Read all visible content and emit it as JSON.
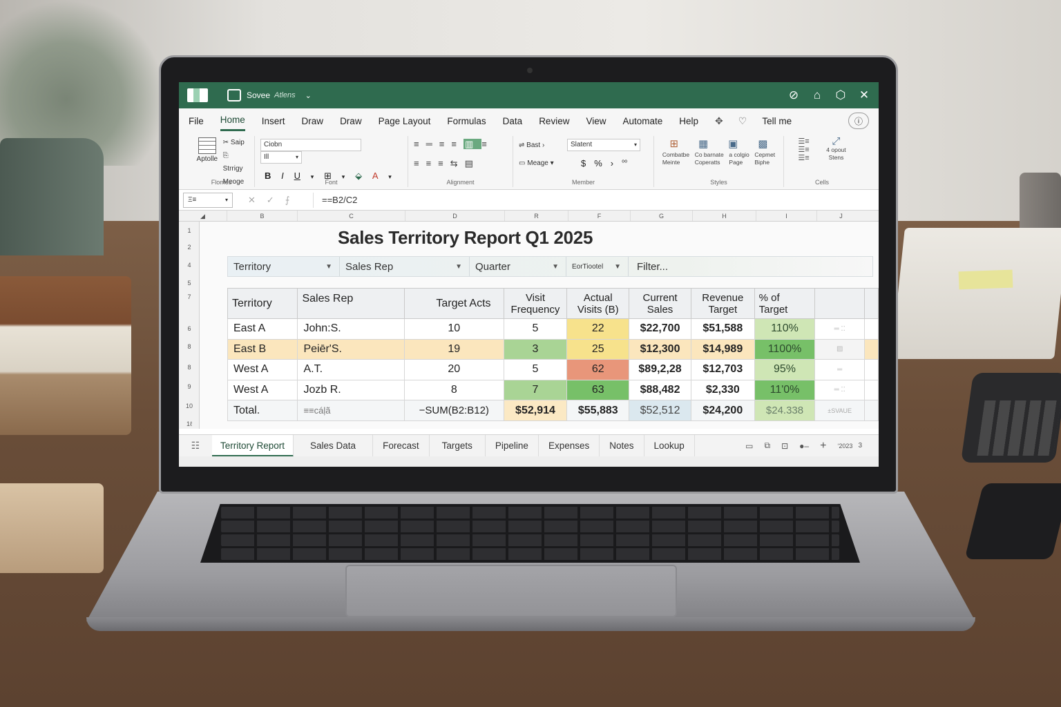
{
  "titlebar": {
    "save_label": "Sovee",
    "sub_label": "Atlens"
  },
  "menu": {
    "items": [
      "File",
      "Home",
      "Insert",
      "Draw",
      "Draw",
      "Page Layout",
      "Formulas",
      "Data",
      "Review",
      "View",
      "Automate",
      "Help"
    ],
    "active": "Home",
    "tell_me": "Tell me"
  },
  "ribbon": {
    "clipboard": {
      "paste": "Aptolle",
      "cut": "Saip",
      "copy": "Strrigy",
      "merge": "Meoge",
      "label": "Flomes"
    },
    "font": {
      "name": "Ciobn",
      "size": "Ill",
      "label": "Font"
    },
    "alignment": {
      "label": "Alignment"
    },
    "number": {
      "wrap": "Bast",
      "merge": "Meage",
      "format": "Slatent",
      "label": "Member"
    },
    "styles": {
      "cond": "Combatbe",
      "cond2": "Meinte",
      "format_table": "Co barnate",
      "format_table2": "Coperatts",
      "cell_styles": "a colgio",
      "cell_styles2": "Page",
      "more": "Cepmet",
      "more2": "Biphe",
      "label": "Styles"
    },
    "cells": {
      "insert": "4 opout",
      "insert2": "Stens",
      "label": "Cells"
    }
  },
  "formula_bar": {
    "name_box": "Ξ≡",
    "formula": "==B2/C2"
  },
  "columns": [
    "B",
    "C",
    "D",
    "R",
    "F",
    "G",
    "H",
    "I",
    "J"
  ],
  "rows": [
    "1",
    "2",
    "4",
    "5",
    "7",
    "6",
    "8",
    "8",
    "9",
    "10",
    "1ℓ"
  ],
  "sheet": {
    "title": "Sales Territory Report Q1 2025",
    "filters": {
      "territory": "Territory",
      "sales_rep": "Sales Rep",
      "quarter": "Quarter",
      "extra": "EorTiootel",
      "filter_input": "Filter..."
    },
    "headers": [
      "Territory",
      "Sales Rep",
      "Target Acts",
      "Visit Frequency",
      "Actual Visits (B)",
      "Current Sales",
      "Revenue Target",
      "% of Target"
    ],
    "rows": [
      {
        "territory": "East A",
        "rep": "John:S.",
        "target": "10",
        "freq": "5",
        "actual": "22",
        "sales": "$22,700",
        "revenue": "$51,588",
        "pct": "110%"
      },
      {
        "territory": "East B",
        "rep": "Peiēr'S.",
        "target": "19",
        "freq": "3",
        "actual": "25",
        "sales": "$12,300",
        "revenue": "$14,989",
        "pct": "1100%"
      },
      {
        "territory": "West A",
        "rep": "A.T.",
        "target": "20",
        "freq": "5",
        "actual": "62",
        "sales": "$89,2,28",
        "revenue": "$12,703",
        "pct": "95%"
      },
      {
        "territory": "West A",
        "rep": "Jozb R.",
        "target": "8",
        "freq": "7",
        "actual": "63",
        "sales": "$88,482",
        "revenue": "$2,330",
        "pct": "11'0%"
      }
    ],
    "total": {
      "label": "Total.",
      "rep": "≡≡cáļã",
      "target": "−SUM(B2:B12)",
      "freq": "$52,914",
      "actual": "$55,883",
      "sales": "$52,512",
      "revenue": "$24,200",
      "pct": "$24.338",
      "extra": "±SVAUE"
    }
  },
  "tabs": [
    "Territory Report",
    "Sales Data",
    "Forecast",
    "Targets",
    "Pipeline",
    "Expenses",
    "Notes",
    "Lookup"
  ],
  "active_tab": "Territory Report",
  "status": {
    "zoom_text": "ʻ2023",
    "page": "3"
  },
  "colors": {
    "accent": "#2f6b4f",
    "highlight_row": "#fbe6bd",
    "green_dark": "#77c068",
    "yellow": "#f7e28c",
    "orange": "#e8967a"
  }
}
